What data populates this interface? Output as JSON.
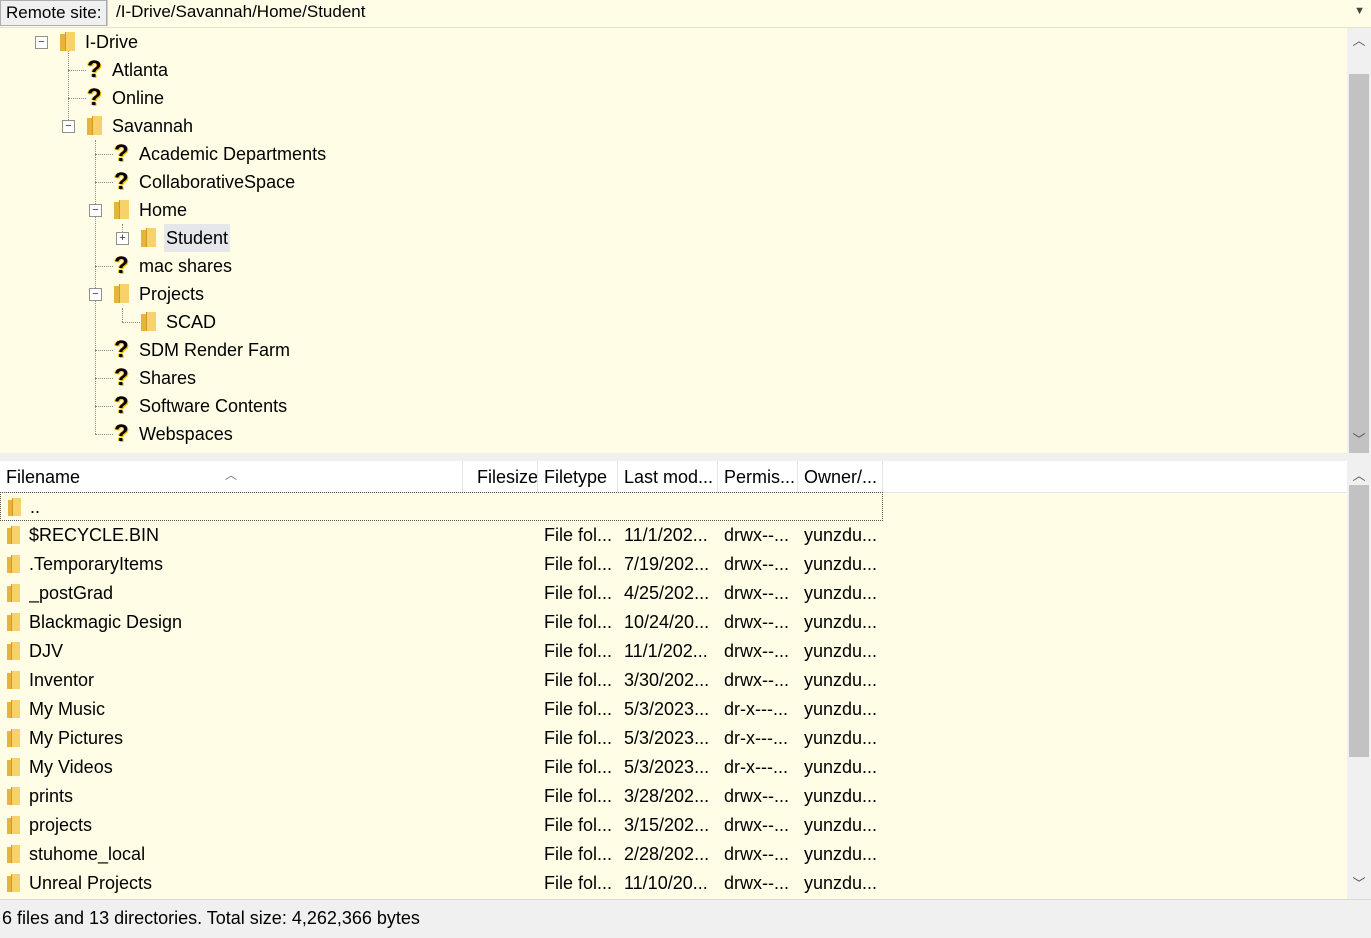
{
  "site_bar": {
    "label": "Remote site:",
    "path": "/I-Drive/Savannah/Home/Student"
  },
  "tree": {
    "nodes": [
      {
        "label": "I-Drive",
        "icon": "folder-icon"
      },
      {
        "label": "Atlanta",
        "icon": "question-icon"
      },
      {
        "label": "Online",
        "icon": "question-icon"
      },
      {
        "label": "Savannah",
        "icon": "folder-icon"
      },
      {
        "label": "Academic Departments",
        "icon": "question-icon"
      },
      {
        "label": "CollaborativeSpace",
        "icon": "question-icon"
      },
      {
        "label": "Home",
        "icon": "folder-icon"
      },
      {
        "label": "Student",
        "icon": "folder-icon",
        "selected": true
      },
      {
        "label": "mac shares",
        "icon": "question-icon"
      },
      {
        "label": "Projects",
        "icon": "folder-icon"
      },
      {
        "label": "SCAD",
        "icon": "folder-icon"
      },
      {
        "label": "SDM Render Farm",
        "icon": "question-icon"
      },
      {
        "label": "Shares",
        "icon": "question-icon"
      },
      {
        "label": "Software Contents",
        "icon": "question-icon"
      },
      {
        "label": "Webspaces",
        "icon": "question-icon"
      }
    ]
  },
  "file_list": {
    "columns": [
      "Filename",
      "Filesize",
      "Filetype",
      "Last mod...",
      "Permis...",
      "Owner/..."
    ],
    "rows": [
      {
        "name": "..",
        "size": "",
        "type": "",
        "modified": "",
        "perms": "",
        "owner": ""
      },
      {
        "name": "$RECYCLE.BIN",
        "size": "",
        "type": "File fol...",
        "modified": "11/1/202...",
        "perms": "drwx--...",
        "owner": "yunzdu..."
      },
      {
        "name": ".TemporaryItems",
        "size": "",
        "type": "File fol...",
        "modified": "7/19/202...",
        "perms": "drwx--...",
        "owner": "yunzdu..."
      },
      {
        "name": "_postGrad",
        "size": "",
        "type": "File fol...",
        "modified": "4/25/202...",
        "perms": "drwx--...",
        "owner": "yunzdu..."
      },
      {
        "name": "Blackmagic Design",
        "size": "",
        "type": "File fol...",
        "modified": "10/24/20...",
        "perms": "drwx--...",
        "owner": "yunzdu..."
      },
      {
        "name": "DJV",
        "size": "",
        "type": "File fol...",
        "modified": "11/1/202...",
        "perms": "drwx--...",
        "owner": "yunzdu..."
      },
      {
        "name": "Inventor",
        "size": "",
        "type": "File fol...",
        "modified": "3/30/202...",
        "perms": "drwx--...",
        "owner": "yunzdu..."
      },
      {
        "name": "My Music",
        "size": "",
        "type": "File fol...",
        "modified": "5/3/2023...",
        "perms": "dr-x---...",
        "owner": "yunzdu..."
      },
      {
        "name": "My Pictures",
        "size": "",
        "type": "File fol...",
        "modified": "5/3/2023...",
        "perms": "dr-x---...",
        "owner": "yunzdu..."
      },
      {
        "name": "My Videos",
        "size": "",
        "type": "File fol...",
        "modified": "5/3/2023...",
        "perms": "dr-x---...",
        "owner": "yunzdu..."
      },
      {
        "name": "prints",
        "size": "",
        "type": "File fol...",
        "modified": "3/28/202...",
        "perms": "drwx--...",
        "owner": "yunzdu..."
      },
      {
        "name": "projects",
        "size": "",
        "type": "File fol...",
        "modified": "3/15/202...",
        "perms": "drwx--...",
        "owner": "yunzdu..."
      },
      {
        "name": "stuhome_local",
        "size": "",
        "type": "File fol...",
        "modified": "2/28/202...",
        "perms": "drwx--...",
        "owner": "yunzdu..."
      },
      {
        "name": "Unreal Projects",
        "size": "",
        "type": "File fol...",
        "modified": "11/10/20...",
        "perms": "drwx--...",
        "owner": "yunzdu..."
      }
    ]
  },
  "status": {
    "text": "6 files and 13 directories. Total size: 4,262,366 bytes"
  },
  "colors": {
    "panel_bg": "#fffde6",
    "folder": "#f7d26b",
    "selection": "#e5e7ea"
  }
}
